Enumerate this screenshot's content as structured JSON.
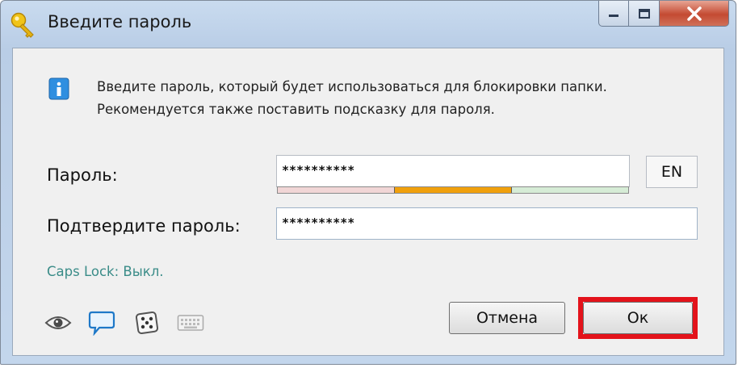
{
  "window": {
    "title": "Введите пароль",
    "icon": "key-icon"
  },
  "title_buttons": {
    "minimize_icon": "minimize-icon",
    "maximize_icon": "maximize-icon",
    "close_icon": "close-icon"
  },
  "info": {
    "icon": "info-icon",
    "line1": "Введите пароль, который будет использоваться для блокировки папки.",
    "line2": "Рекомендуется также поставить подсказку для пароля."
  },
  "password": {
    "label": "Пароль:",
    "value": "**********",
    "strength_colors": [
      "#f1d6d6",
      "#f0a00c",
      "#d6ecd6"
    ]
  },
  "confirm": {
    "label": "Подтвердите пароль:",
    "value": "**********"
  },
  "language": {
    "label": "EN"
  },
  "caps_lock": {
    "text": "Caps Lock: Выкл."
  },
  "tools": [
    "eye-icon",
    "hint-bubble-icon",
    "dice-icon",
    "keyboard-icon"
  ],
  "buttons": {
    "cancel": "Отмена",
    "ok": "Ок",
    "highlight_color": "#e3131b"
  }
}
